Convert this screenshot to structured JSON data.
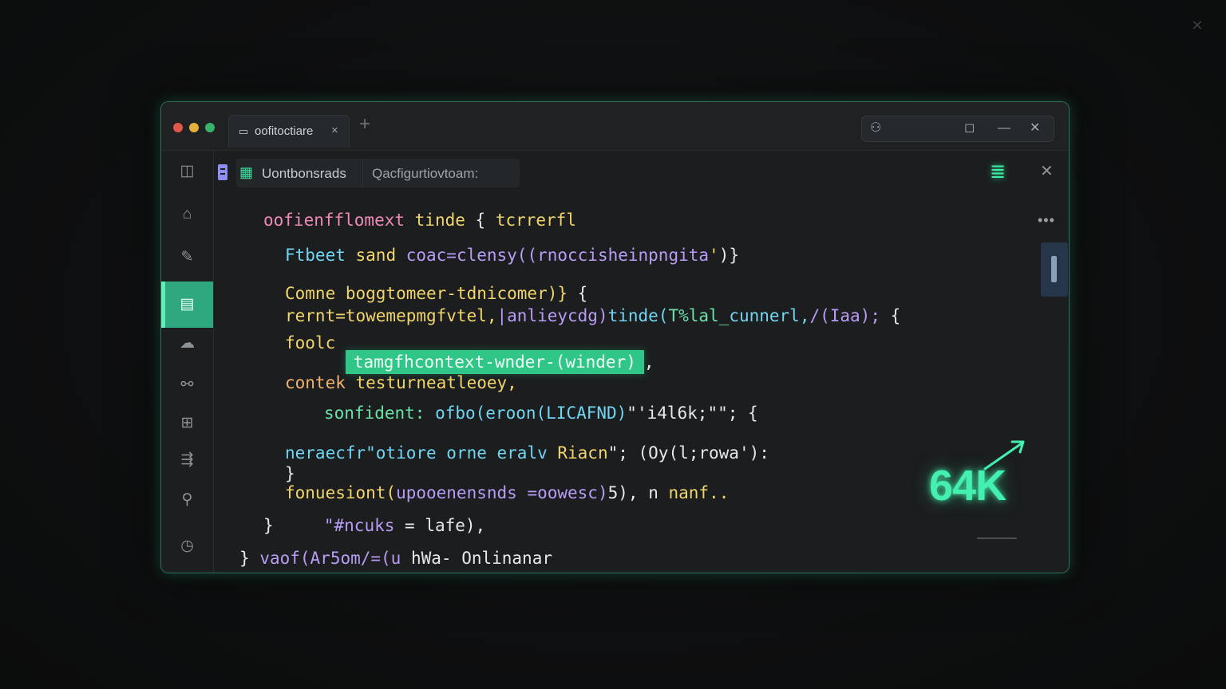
{
  "window": {
    "tab_title": "oofitoctiare",
    "tab_lock_icon": "lock-icon",
    "tab_close_glyph": "×",
    "new_tab_glyph": "+",
    "controls": {
      "user": "⚇",
      "maximize": "◻",
      "minimize": "—",
      "close": "✕"
    }
  },
  "sidebar": {
    "items": [
      {
        "name": "panels-icon",
        "glyph": "◫"
      },
      {
        "name": "home-icon",
        "glyph": "⌂"
      },
      {
        "name": "brush-icon",
        "glyph": "✎"
      },
      {
        "name": "document-icon",
        "glyph": "▤"
      },
      {
        "name": "cloud-icon",
        "glyph": "☁"
      },
      {
        "name": "link-icon",
        "glyph": "⚯"
      },
      {
        "name": "extensions-icon",
        "glyph": "⊞"
      },
      {
        "name": "bookmarks-icon",
        "glyph": "⇶"
      },
      {
        "name": "pin-icon",
        "glyph": "⚲"
      },
      {
        "name": "clock-icon",
        "glyph": "◷"
      }
    ],
    "active_index": 3
  },
  "toolbar": {
    "breadcrumb_label": "Uontbonsrads",
    "search_text": "Qacfigurtiovtoam:",
    "panel_icon": "≣",
    "close_glyph": "✕",
    "more_glyph": "•••"
  },
  "code": {
    "lines": [
      [
        {
          "t": "oofienfflomext ",
          "c": "pink"
        },
        {
          "t": "tinde ",
          "c": "yellow"
        },
        {
          "t": "{ ",
          "c": "white"
        },
        {
          "t": "tcrrerfl",
          "c": "yellow"
        }
      ],
      [
        {
          "t": "Ftbeet ",
          "c": "cyan"
        },
        {
          "t": "sand ",
          "c": "yellow"
        },
        {
          "t": "coac=clensy((rnoccisheinpngita",
          "c": "violet"
        },
        {
          "t": "'",
          "c": "yellow"
        },
        {
          "t": ")}",
          "c": "white"
        }
      ],
      [
        {
          "t": "Comne ",
          "c": "yellow"
        },
        {
          "t": "boggtomeer-tdnicomer)} ",
          "c": "yellow"
        },
        {
          "t": "{",
          "c": "white"
        }
      ],
      [
        {
          "t": "rernt=towemepmgfvtel,",
          "c": "yellow"
        },
        {
          "t": "|anlieycdg)",
          "c": "violet"
        },
        {
          "t": "tinde(",
          "c": "cyan"
        },
        {
          "t": "T%lal_",
          "c": "green"
        },
        {
          "t": "cunnerl,",
          "c": "cyan"
        },
        {
          "t": "/(Iaa); ",
          "c": "violet"
        },
        {
          "t": "{",
          "c": "white"
        }
      ],
      [
        {
          "t": "foolc ",
          "c": "yellow"
        }
      ],
      [
        {
          "t": "contek ",
          "c": "orange"
        },
        {
          "t": "testurneatleoey,",
          "c": "yellow"
        }
      ],
      [
        {
          "t": "sonfident: ",
          "c": "green"
        },
        {
          "t": "ofbo(eroon(LICAFND)",
          "c": "cyan"
        },
        {
          "t": "\"'i4l6k;\"\"; ",
          "c": "white"
        },
        {
          "t": "{",
          "c": "white"
        }
      ],
      [
        {
          "t": "neraecfr\"otiore ",
          "c": "cyan"
        },
        {
          "t": "orne ",
          "c": "cyan"
        },
        {
          "t": "eralv ",
          "c": "cyan"
        },
        {
          "t": "Riacn",
          "c": "yellow"
        },
        {
          "t": "\"; (Oy(l;rowa'):",
          "c": "white"
        }
      ],
      [
        {
          "t": "}",
          "c": "white"
        }
      ],
      [
        {
          "t": "fonuesiont(",
          "c": "yellow"
        },
        {
          "t": "upooenensnds ",
          "c": "violet"
        },
        {
          "t": "=oowesc)",
          "c": "violet"
        },
        {
          "t": "5),",
          "c": "white"
        },
        {
          "t": " n ",
          "c": "white"
        },
        {
          "t": "nanf..",
          "c": "yellow"
        }
      ],
      [
        {
          "t": "}",
          "c": "white"
        },
        {
          "t": "     ",
          "c": "white"
        },
        {
          "t": "\"#ncuks ",
          "c": "violet"
        },
        {
          "t": "= ",
          "c": "white"
        },
        {
          "t": "lafe),",
          "c": "white"
        }
      ],
      [
        {
          "t": "}",
          "c": "white"
        },
        {
          "t": " ",
          "c": "white"
        },
        {
          "t": "vaof(Ar5om/=(u ",
          "c": "violet"
        },
        {
          "t": "hWa- ",
          "c": "white"
        },
        {
          "t": "Onlinanar",
          "c": "white"
        }
      ]
    ],
    "highlight": "tamgfhcontext-wnder-(winder)",
    "highlight_trail": ","
  },
  "stat": {
    "value": "64K",
    "trend_icon": "trend-up-arrow-icon"
  },
  "colors": {
    "accent": "#3af0a6",
    "active_sidebar": "#2fa880",
    "window_border": "#2f6f59"
  },
  "page_close_glyph": "✕"
}
